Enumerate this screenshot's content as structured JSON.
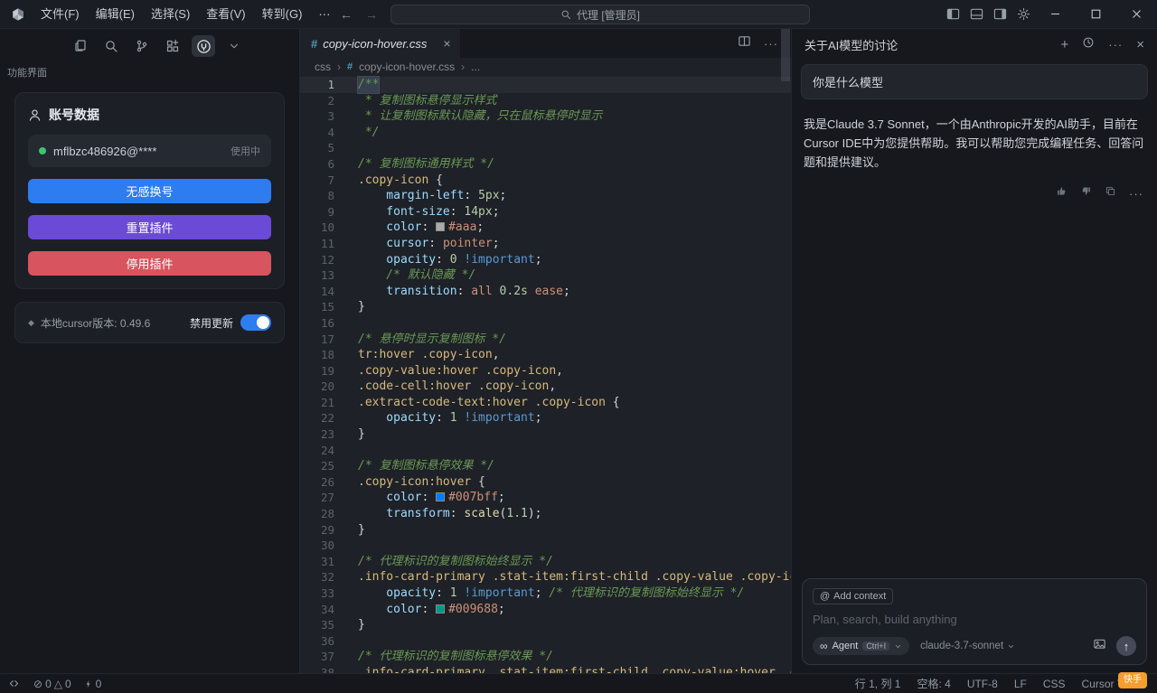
{
  "titlebar": {
    "menus": [
      "文件(F)",
      "编辑(E)",
      "选择(S)",
      "查看(V)",
      "转到(G)"
    ],
    "search_text": "代理 [管理员]"
  },
  "icons": {
    "overflow": "···",
    "back": "←",
    "forward": "→",
    "close": "×",
    "plus": "+",
    "at": "@",
    "infinity": "∞",
    "send": "↑",
    "diamond": "◆",
    "error": "⊘",
    "warning": "△",
    "crumb_sep": "›",
    "hash": "#",
    "more": "···"
  },
  "sidebar": {
    "panel_label": "功能界面",
    "account_title": "账号数据",
    "email": "mflbzc486926@****",
    "email_status": "使用中",
    "btn_switch": "无感换号",
    "btn_reset": "重置插件",
    "btn_disable": "停用插件",
    "version_text": "本地cursor版本: 0.49.6",
    "update_label": "禁用更新"
  },
  "colors": {
    "accent_blue": "#2e7df0",
    "accent_purple": "#6a4ad6",
    "accent_red": "#d8545f",
    "toggle_on": "#2e7df0",
    "status_green": "#3ec46d",
    "badge_orange": "#f59e2d"
  },
  "editor": {
    "tab_title": "copy-icon-hover.css",
    "breadcrumb_root": "css",
    "breadcrumb_file": "copy-icon-hover.css",
    "breadcrumb_more": "...",
    "lines": [
      [
        [
          "cm",
          "/**"
        ]
      ],
      [
        [
          "cm",
          " * 复制图标悬停显示样式"
        ]
      ],
      [
        [
          "cm",
          " * 让复制图标默认隐藏，只在鼠标悬停时显示"
        ]
      ],
      [
        [
          "cm",
          " */"
        ]
      ],
      [],
      [
        [
          "cm",
          "/* 复制图标通用样式 */"
        ]
      ],
      [
        [
          "sel",
          ".copy-icon"
        ],
        [
          "pu",
          " {"
        ]
      ],
      [
        [
          "pr",
          "    margin-left"
        ],
        [
          "pu",
          ": "
        ],
        [
          "nu",
          "5px"
        ],
        [
          "pu",
          ";"
        ]
      ],
      [
        [
          "pr",
          "    font-size"
        ],
        [
          "pu",
          ": "
        ],
        [
          "nu",
          "14px"
        ],
        [
          "pu",
          ";"
        ]
      ],
      [
        [
          "pr",
          "    color"
        ],
        [
          "pu",
          ": "
        ],
        [
          "va",
          "#aaa",
          "#aaaaaa"
        ],
        [
          "pu",
          ";"
        ]
      ],
      [
        [
          "pr",
          "    cursor"
        ],
        [
          "pu",
          ": "
        ],
        [
          "va",
          "pointer"
        ],
        [
          "pu",
          ";"
        ]
      ],
      [
        [
          "pr",
          "    opacity"
        ],
        [
          "pu",
          ": "
        ],
        [
          "nu",
          "0"
        ],
        [
          "pu",
          " "
        ],
        [
          "im",
          "!important"
        ],
        [
          "pu",
          ";"
        ]
      ],
      [
        [
          "cm",
          "    /* 默认隐藏 */"
        ]
      ],
      [
        [
          "pr",
          "    transition"
        ],
        [
          "pu",
          ": "
        ],
        [
          "va",
          "all"
        ],
        [
          "pu",
          " "
        ],
        [
          "nu",
          "0.2s"
        ],
        [
          "pu",
          " "
        ],
        [
          "va",
          "ease"
        ],
        [
          "pu",
          ";"
        ]
      ],
      [
        [
          "pu",
          "}"
        ]
      ],
      [],
      [
        [
          "cm",
          "/* 悬停时显示复制图标 */"
        ]
      ],
      [
        [
          "sel",
          "tr:hover .copy-icon"
        ],
        [
          "pu",
          ","
        ]
      ],
      [
        [
          "sel",
          ".copy-value:hover .copy-icon"
        ],
        [
          "pu",
          ","
        ]
      ],
      [
        [
          "sel",
          ".code-cell:hover .copy-icon"
        ],
        [
          "pu",
          ","
        ]
      ],
      [
        [
          "sel",
          ".extract-code-text:hover .copy-icon"
        ],
        [
          "pu",
          " {"
        ]
      ],
      [
        [
          "pr",
          "    opacity"
        ],
        [
          "pu",
          ": "
        ],
        [
          "nu",
          "1"
        ],
        [
          "pu",
          " "
        ],
        [
          "im",
          "!important"
        ],
        [
          "pu",
          ";"
        ]
      ],
      [
        [
          "pu",
          "}"
        ]
      ],
      [],
      [
        [
          "cm",
          "/* 复制图标悬停效果 */"
        ]
      ],
      [
        [
          "sel",
          ".copy-icon:hover"
        ],
        [
          "pu",
          " {"
        ]
      ],
      [
        [
          "pr",
          "    color"
        ],
        [
          "pu",
          ": "
        ],
        [
          "va",
          "#007bff",
          "#007bff"
        ],
        [
          "pu",
          ";"
        ]
      ],
      [
        [
          "pr",
          "    transform"
        ],
        [
          "pu",
          ": "
        ],
        [
          "fn",
          "scale"
        ],
        [
          "pu",
          "("
        ],
        [
          "nu",
          "1.1"
        ],
        [
          "pu",
          ");"
        ]
      ],
      [
        [
          "pu",
          "}"
        ]
      ],
      [],
      [
        [
          "cm",
          "/* 代理标识的复制图标始终显示 */"
        ]
      ],
      [
        [
          "sel",
          ".info-card-primary .stat-item:first-child .copy-value .copy-icon"
        ],
        [
          "pu",
          " {"
        ]
      ],
      [
        [
          "pr",
          "    opacity"
        ],
        [
          "pu",
          ": "
        ],
        [
          "nu",
          "1"
        ],
        [
          "pu",
          " "
        ],
        [
          "im",
          "!important"
        ],
        [
          "pu",
          "; "
        ],
        [
          "cm",
          "/* 代理标识的复制图标始终显示 */"
        ]
      ],
      [
        [
          "pr",
          "    color"
        ],
        [
          "pu",
          ": "
        ],
        [
          "va",
          "#009688",
          "#009688"
        ],
        [
          "pu",
          ";"
        ]
      ],
      [
        [
          "pu",
          "}"
        ]
      ],
      [],
      [
        [
          "cm",
          "/* 代理标识的复制图标悬停效果 */"
        ]
      ],
      [
        [
          "sel",
          ".info-card-primary .stat-item:first-child .copy-value:hover .copy-i"
        ]
      ]
    ]
  },
  "chat": {
    "title": "关于AI模型的讨论",
    "user_message": "你是什么模型",
    "ai_message": "我是Claude 3.7 Sonnet，一个由Anthropic开发的AI助手，目前在Cursor IDE中为您提供帮助。我可以帮助您完成编程任务、回答问题和提供建议。",
    "add_context": "Add context",
    "input_placeholder": "Plan, search, build anything",
    "agent_label": "Agent",
    "agent_kbd": "Ctrl+I",
    "model_name": "claude-3.7-sonnet"
  },
  "statusbar": {
    "errors": "0",
    "warnings": "0",
    "extra_count": "0",
    "line_col": "行 1, 列 1",
    "indent": "空格: 4",
    "encoding": "UTF-8",
    "eol": "LF",
    "language": "CSS",
    "cursor_tab": "Cursor Tab"
  },
  "watermark": "快手"
}
